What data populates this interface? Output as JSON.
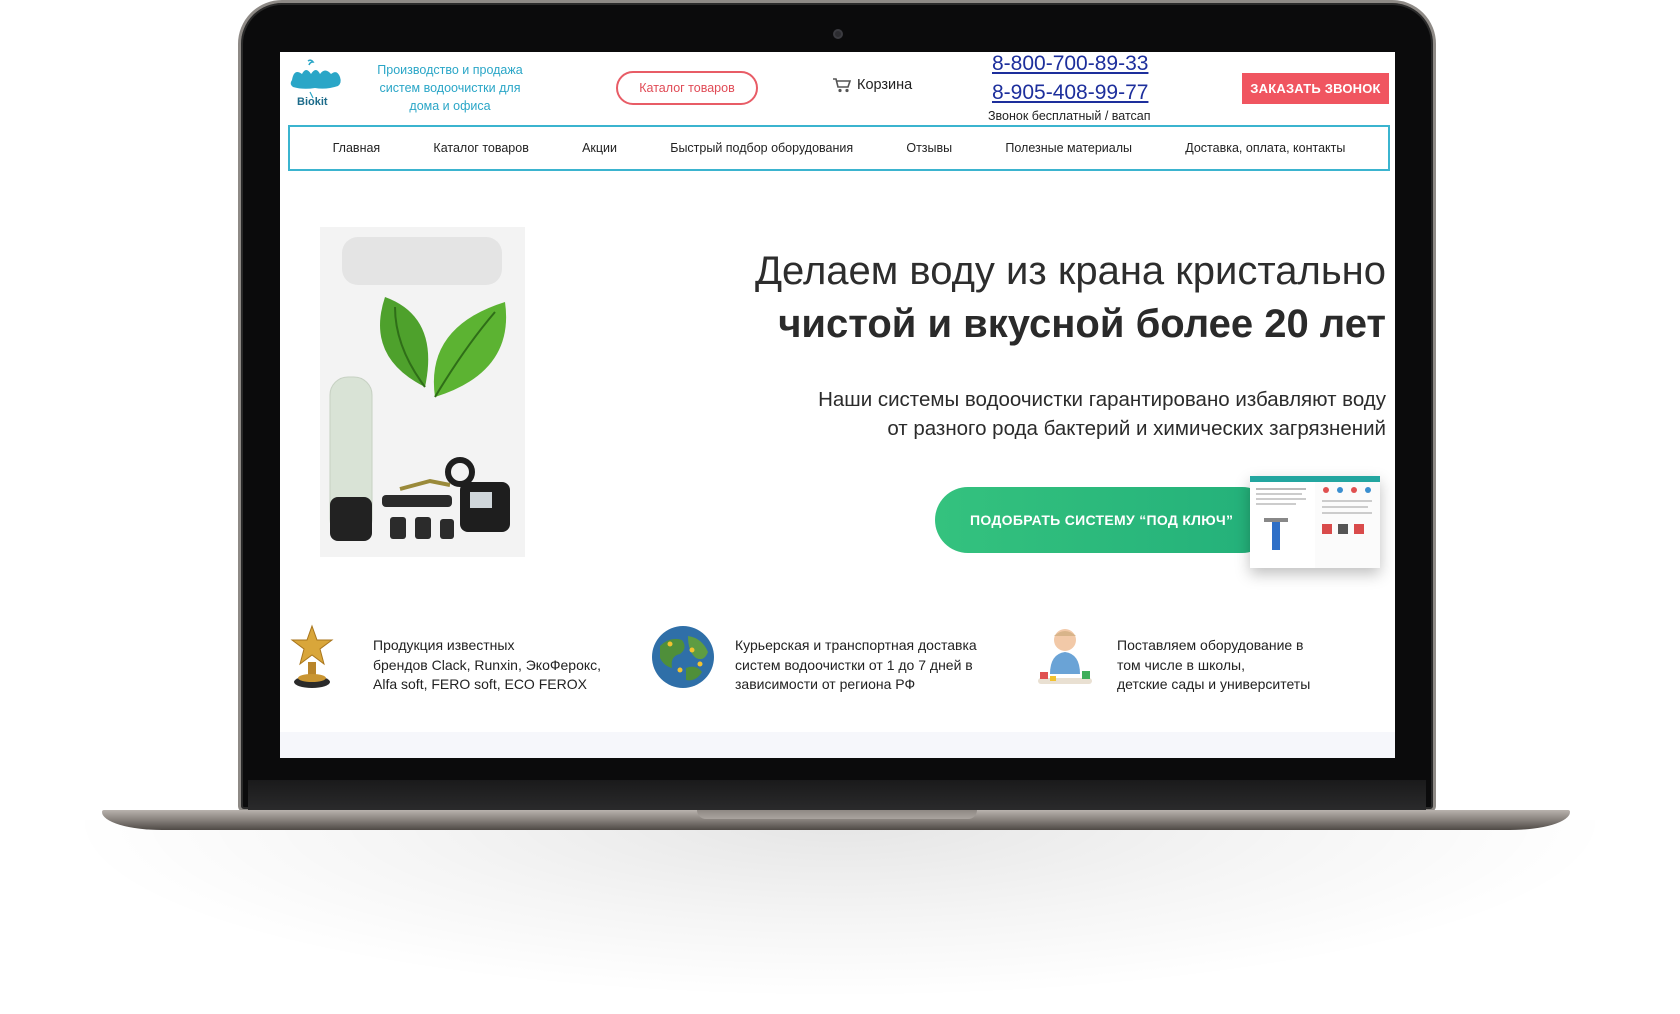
{
  "header": {
    "logo_text": "Biokit",
    "tagline": [
      "Производство и продажа",
      "систем водоочистки для",
      "дома и офиса"
    ],
    "catalog_button": "Каталог товаров",
    "cart_label": "Корзина",
    "phone_primary": "8-800-700-89-33",
    "phone_secondary": "8-905-408-99-77",
    "phone_note": "Звонок бесплатный / ватсап",
    "callback_button": "ЗАКАЗАТЬ ЗВОНОК"
  },
  "nav": {
    "items": [
      "Главная",
      "Каталог товаров",
      "Акции",
      "Быстрый подбор оборудования",
      "Отзывы",
      "Полезные материалы",
      "Доставка, оплата, контакты"
    ]
  },
  "hero": {
    "title_line1": "Делаем воду из крана кристально",
    "title_line2": "чистой и вкусной более 20 лет",
    "subtitle_line1": "Наши системы водоочистки гарантировано избавляют воду",
    "subtitle_line2": "от разного рода бактерий и химических загрязнений",
    "cta_button": "ПОДОБРАТЬ СИСТЕМУ “ПОД КЛЮЧ”"
  },
  "features": [
    {
      "icon": "trophy-icon",
      "lines": [
        "Продукция известных",
        "брендов Clack, Runxin, ЭкоФерокс,",
        "Alfa soft, FERO soft, ECO FEROX"
      ]
    },
    {
      "icon": "globe-icon",
      "lines": [
        "Курьерская и транспортная доставка",
        "систем водоочистки от 1 до 7 дней в",
        "зависимости от региона РФ"
      ]
    },
    {
      "icon": "child-icon",
      "lines": [
        "Поставляем оборудование в",
        "том числе в школы,",
        "детские сады и университеты"
      ]
    }
  ],
  "colors": {
    "accent_blue": "#3bb4cf",
    "accent_red": "#f05560",
    "cta_green": "#2dba7c",
    "phone_blue": "#1d2f9c"
  }
}
